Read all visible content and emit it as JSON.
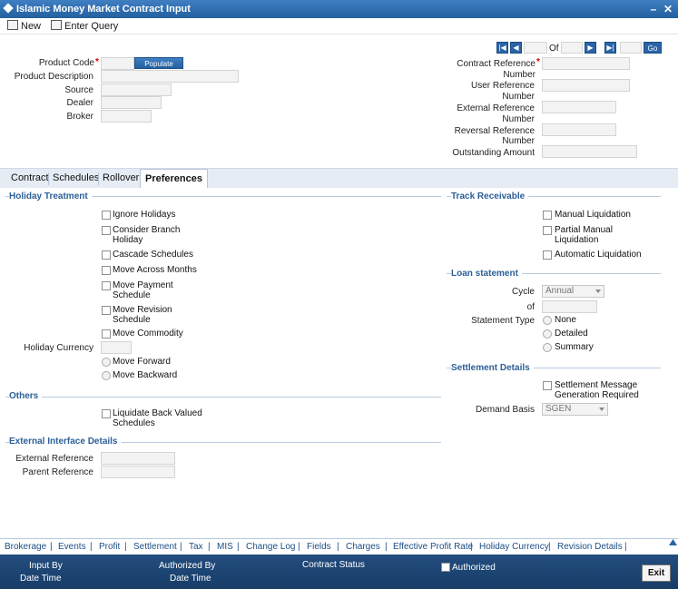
{
  "window": {
    "title": "Islamic Money Market Contract Input",
    "minimize": "–",
    "close": "✕"
  },
  "toolbar": {
    "new_label": "New",
    "enter_query_label": "Enter Query"
  },
  "header": {
    "product_code_label": "Product Code",
    "required_mark": "*",
    "populate_label": "Populate",
    "product_description_label": "Product Description",
    "source_label": "Source",
    "dealer_label": "Dealer",
    "broker_label": "Broker",
    "contract_reference_label_1": "Contract Reference",
    "contract_reference_label_2": "Number",
    "user_reference_label_1": "User Reference",
    "user_reference_label_2": "Number",
    "external_reference_label_1": "External Reference",
    "external_reference_label_2": "Number",
    "reversal_reference_label_1": "Reversal Reference",
    "reversal_reference_label_2": "Number",
    "outstanding_amount_label": "Outstanding Amount",
    "of_label": "Of",
    "go_label": "Go"
  },
  "tabs": [
    {
      "label": "Contract"
    },
    {
      "label": "Schedules"
    },
    {
      "label": "Rollover"
    },
    {
      "label": "Preferences"
    }
  ],
  "holiday": {
    "title": "Holiday Treatment",
    "ignore_holidays": "Ignore Holidays",
    "consider_branch_1": "Consider Branch",
    "consider_branch_2": "Holiday",
    "cascade_schedules": "Cascade Schedules",
    "move_across_months": "Move Across Months",
    "move_payment_1": "Move Payment",
    "move_payment_2": "Schedule",
    "move_revision_1": "Move Revision",
    "move_revision_2": "Schedule",
    "move_commodity": "Move Commodity",
    "holiday_currency_label": "Holiday Currency",
    "move_forward": "Move Forward",
    "move_backward": "Move Backward"
  },
  "others": {
    "title": "Others",
    "liquidate_1": "Liquidate Back Valued",
    "liquidate_2": "Schedules"
  },
  "external_interface": {
    "title": "External Interface Details",
    "external_reference_label": "External Reference",
    "parent_reference_label": "Parent Reference"
  },
  "track_receivable": {
    "title": "Track Receivable",
    "manual_liquidation": "Manual Liquidation",
    "partial_manual_1": "Partial Manual",
    "partial_manual_2": "Liquidation",
    "automatic_liquidation": "Automatic Liquidation"
  },
  "loan_statement": {
    "title": "Loan statement",
    "cycle_label": "Cycle",
    "cycle_value": "Annual",
    "of_label": "of",
    "statement_type_label": "Statement Type",
    "none": "None",
    "detailed": "Detailed",
    "summary": "Summary"
  },
  "settlement": {
    "title": "Settlement Details",
    "msg_1": "Settlement Message",
    "msg_2": "Generation Required",
    "demand_basis_label": "Demand Basis",
    "demand_basis_value": "SGEN"
  },
  "footer_links": [
    "Brokerage",
    "Events",
    "Profit",
    "Settlement",
    "Tax",
    "MIS",
    "Change Log",
    "Fields",
    "Charges",
    "Effective Profit Rate",
    "Holiday Currency",
    "Revision Details"
  ],
  "footer": {
    "input_by": "Input By",
    "date_time": "Date Time",
    "authorized_by": "Authorized By",
    "contract_status": "Contract Status",
    "authorized": "Authorized",
    "exit": "Exit"
  }
}
